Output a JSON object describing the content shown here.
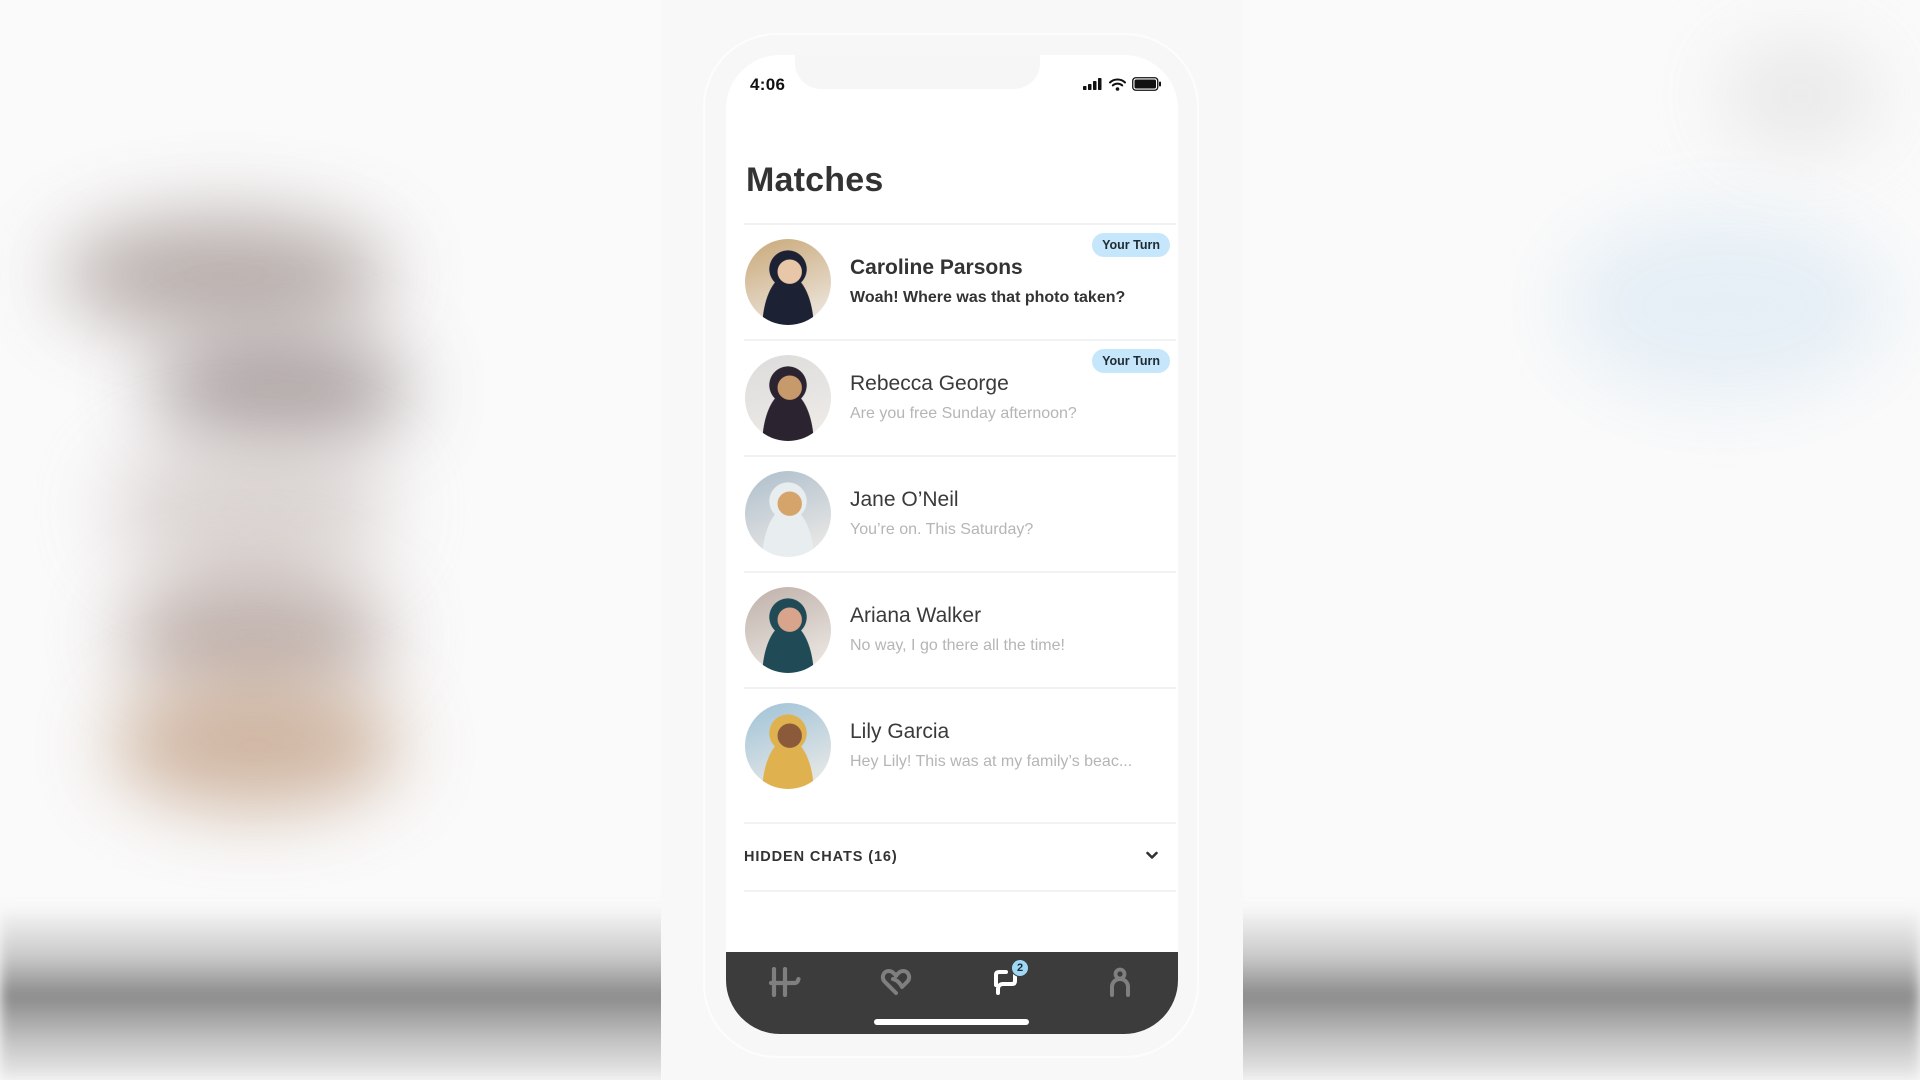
{
  "status_bar": {
    "time": "4:06",
    "icons": [
      "cellular-signal-icon",
      "wifi-icon",
      "battery-icon"
    ]
  },
  "page": {
    "title": "Matches"
  },
  "matches": [
    {
      "name": "Caroline Parsons",
      "preview": "Woah! Where was that photo taken?",
      "badge": "Your Turn",
      "unread": true,
      "avatar_colors": [
        "#c9a878",
        "#1c2233",
        "#e8c7a8"
      ]
    },
    {
      "name": "Rebecca George",
      "preview": "Are you free Sunday afternoon?",
      "badge": "Your Turn",
      "unread": false,
      "avatar_colors": [
        "#dcdcdc",
        "#2b2330",
        "#c79a6c"
      ]
    },
    {
      "name": "Jane O’Neil",
      "preview": "You’re on. This Saturday?",
      "badge": "",
      "unread": false,
      "avatar_colors": [
        "#aebfcc",
        "#e8eef0",
        "#d4a46a"
      ]
    },
    {
      "name": "Ariana Walker",
      "preview": "No way, I go there all the time!",
      "badge": "",
      "unread": false,
      "avatar_colors": [
        "#bfb1aa",
        "#1f4a56",
        "#d8a48b"
      ]
    },
    {
      "name": "Lily Garcia",
      "preview": "Hey Lily! This was at my family’s beac...",
      "badge": "",
      "unread": false,
      "avatar_colors": [
        "#9fc3d8",
        "#e0b14f",
        "#8a5a3a"
      ]
    }
  ],
  "hidden_chats": {
    "label": "HIDDEN CHATS (16)",
    "count": 16
  },
  "tab_bar": {
    "tabs": [
      {
        "name": "discover",
        "icon": "hinge-logo-icon",
        "active": false
      },
      {
        "name": "likes",
        "icon": "heart-icon",
        "active": false
      },
      {
        "name": "matches",
        "icon": "chat-bubbles-icon",
        "active": true,
        "badge": "2"
      },
      {
        "name": "profile",
        "icon": "profile-icon",
        "active": false
      }
    ]
  },
  "colors": {
    "badge_bg": "#c6e7fb",
    "tab_bar_bg": "#3c3c3c",
    "tab_inactive": "#7f7f7f",
    "tab_active": "#ffffff",
    "notification_badge": "#9fd8f5"
  }
}
